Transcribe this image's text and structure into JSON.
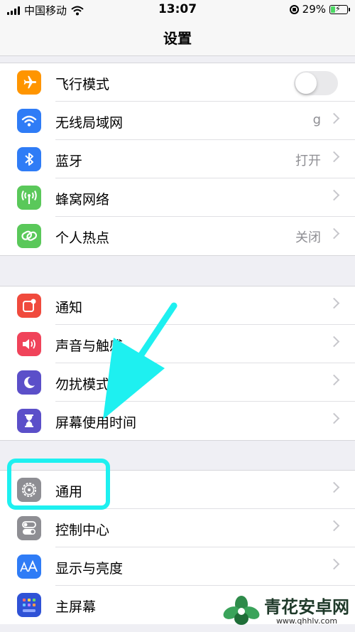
{
  "status_bar": {
    "carrier": "中国移动",
    "time": "13:07",
    "battery_percent": "29%",
    "battery_level": 0.29
  },
  "nav": {
    "title": "设置"
  },
  "groups": [
    {
      "items": [
        {
          "label": "飞行模式",
          "icon": "airplane-icon",
          "color": "#ff9500",
          "control": "toggle",
          "toggle_on": false
        },
        {
          "label": "无线局域网",
          "icon": "wifi-icon",
          "color": "#2f7cf6",
          "value": "g"
        },
        {
          "label": "蓝牙",
          "icon": "bluetooth-icon",
          "color": "#2f7cf6",
          "value": "打开"
        },
        {
          "label": "蜂窝网络",
          "icon": "antenna-icon",
          "color": "#5ac85a"
        },
        {
          "label": "个人热点",
          "icon": "chain-link-icon",
          "color": "#5ac85a",
          "value": "关闭"
        }
      ]
    },
    {
      "items": [
        {
          "label": "通知",
          "icon": "notification-icon",
          "color": "#f04a3d"
        },
        {
          "label": "声音与触感",
          "icon": "speaker-icon",
          "color": "#f0435a"
        },
        {
          "label": "勿扰模式",
          "icon": "moon-icon",
          "color": "#5b4fc9"
        },
        {
          "label": "屏幕使用时间",
          "icon": "hourglass-icon",
          "color": "#5b4fc9"
        }
      ]
    },
    {
      "items": [
        {
          "label": "通用",
          "icon": "gear-icon",
          "color": "#8e8e93"
        },
        {
          "label": "控制中心",
          "icon": "toggles-icon",
          "color": "#8e8e93"
        },
        {
          "label": "显示与亮度",
          "icon": "text-size-icon",
          "color": "#2f7cf6"
        },
        {
          "label": "主屏幕",
          "icon": "home-grid-icon",
          "color": "#2f52d6"
        }
      ]
    }
  ],
  "annotation": {
    "highlight_color": "#1ef0f0",
    "arrow_color": "#1ef0f0"
  },
  "watermark": {
    "title": "青花安卓网",
    "url": "www.qhhlv.com"
  }
}
